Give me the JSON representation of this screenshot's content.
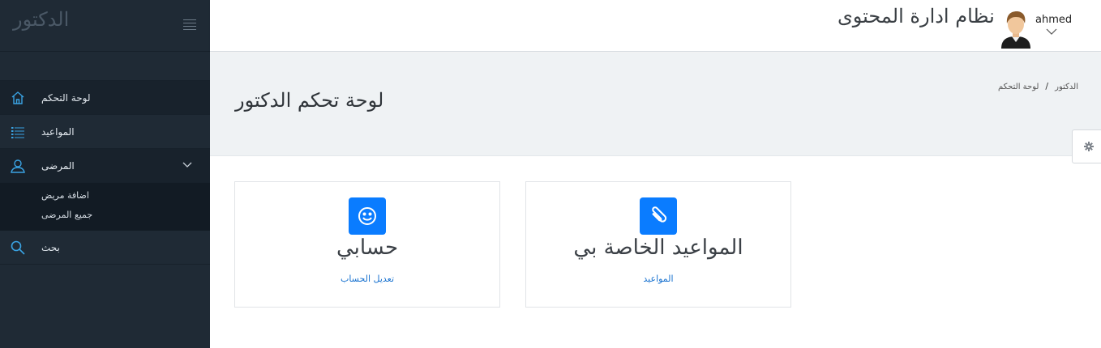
{
  "sidebar": {
    "brand": "الدكتور",
    "items": [
      {
        "label": "لوحة التحكم",
        "icon": "home-icon"
      },
      {
        "label": "المواعيد",
        "icon": "list-icon"
      },
      {
        "label": "المرضى",
        "icon": "user-icon"
      },
      {
        "label": "بحث",
        "icon": "search-icon"
      }
    ],
    "patients_sub": [
      "اضافة مريض",
      "جميع المرضى"
    ]
  },
  "header": {
    "title": "نظام ادارة المحتوى",
    "username": "ahmed"
  },
  "page": {
    "title": "لوحة تحكم الدكتور",
    "breadcrumb": [
      "لوحة التحكم",
      "الدكتور"
    ],
    "breadcrumb_sep": "/"
  },
  "cards": [
    {
      "title": "حسابي",
      "link": "تعديل الحساب",
      "icon": "smiley-icon"
    },
    {
      "title": "المواعيد الخاصة بي",
      "link": "المواعيد",
      "icon": "paperclip-icon"
    }
  ],
  "colors": {
    "sidebar_bg": "#1f2a35",
    "accent_blue": "#0a7cff",
    "sidebar_icon": "#3aa3e3",
    "page_head_bg": "#eff2f4"
  }
}
